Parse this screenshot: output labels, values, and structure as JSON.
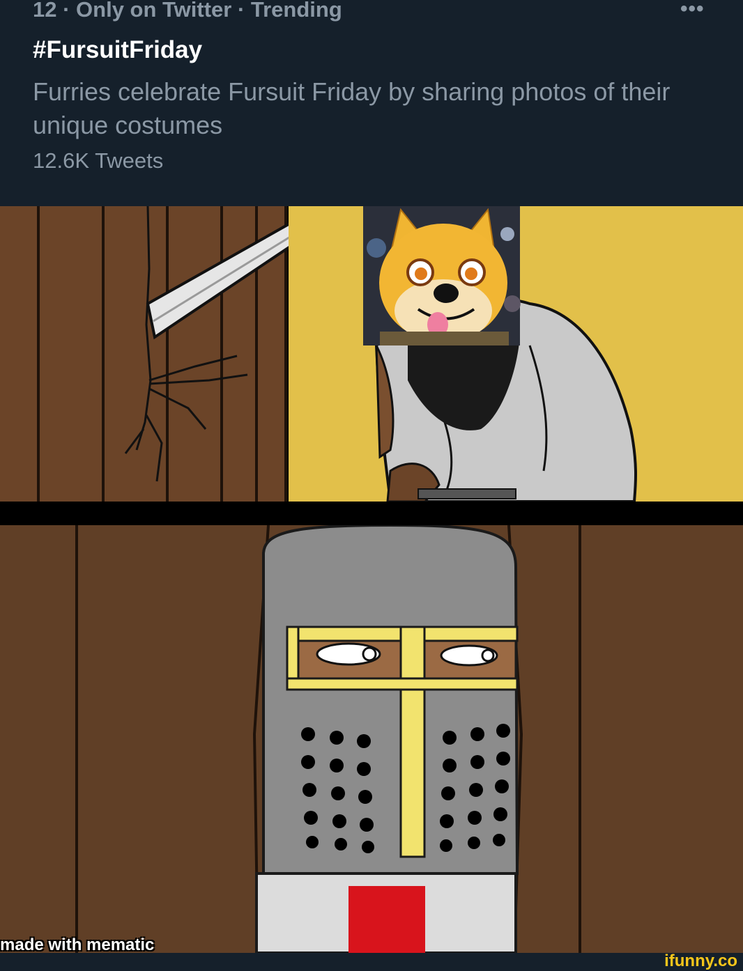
{
  "trend": {
    "meta": "12 · Only on Twitter · Trending",
    "hashtag": "#FursuitFriday",
    "description": "Furries celebrate Fursuit Friday by sharing photos of their unique costumes",
    "count": "12.6K Tweets",
    "more_icon": "more-dots-icon"
  },
  "watermarks": {
    "mematic": "made with mematic",
    "ifunny": "ifunny.co"
  },
  "colors": {
    "background": "#15202b",
    "secondary_text": "#8b98a5",
    "wall_yellow": "#e2c04a",
    "door_brown": "#6b4428",
    "helmet_gray": "#8c8c8c",
    "visor_yellow": "#f2e36e",
    "cross_red": "#d8141c"
  }
}
